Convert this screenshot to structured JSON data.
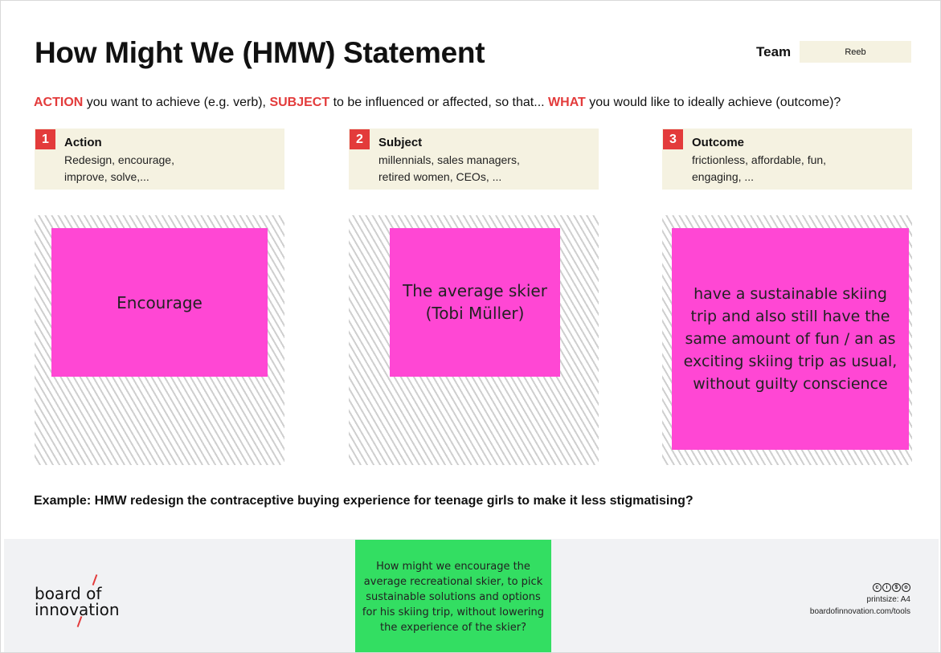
{
  "header": {
    "title": "How Might We (HMW) Statement",
    "team_label": "Team",
    "team_value": "Reeb"
  },
  "subtitle": {
    "action_word": "ACTION",
    "action_text": " you want to achieve (e.g. verb), ",
    "subject_word": "SUBJECT",
    "subject_text": " to be influenced or affected, so that... ",
    "what_word": "WHAT",
    "what_text": " you would like to ideally achieve (outcome)?"
  },
  "columns": [
    {
      "number": "1",
      "heading": "Action",
      "desc_line1": "Redesign, encourage,",
      "desc_line2": "improve, solve,...",
      "sticky_text": "Encourage"
    },
    {
      "number": "2",
      "heading": "Subject",
      "desc_line1": "millennials, sales managers,",
      "desc_line2": "retired women, CEOs, ...",
      "sticky_text": "The average skier (Tobi Müller)"
    },
    {
      "number": "3",
      "heading": "Outcome",
      "desc_line1": "frictionless, affordable, fun,",
      "desc_line2": "engaging, ...",
      "sticky_text": "have a sustainable skiing trip and also still have the same amount of fun / an as exciting skiing trip as usual, without guilty conscience"
    }
  ],
  "example": "Example: HMW redesign the contraceptive buying experience for teenage girls to make it less stigmatising?",
  "footer": {
    "logo_line1": "board of",
    "logo_line2": "innovation",
    "hmw_note": "How might we encourage the average recreational skier, to pick sustainable solutions and options for his skiing trip, without lowering the experience of the skier?",
    "printsize": "printsize: A4",
    "url": "boardofinnovation.com/tools"
  },
  "colors": {
    "accent_red": "#e33b3b",
    "sticky_pink": "#ff47d4",
    "sticky_green": "#33de62",
    "info_bg": "#f5f2e1"
  }
}
